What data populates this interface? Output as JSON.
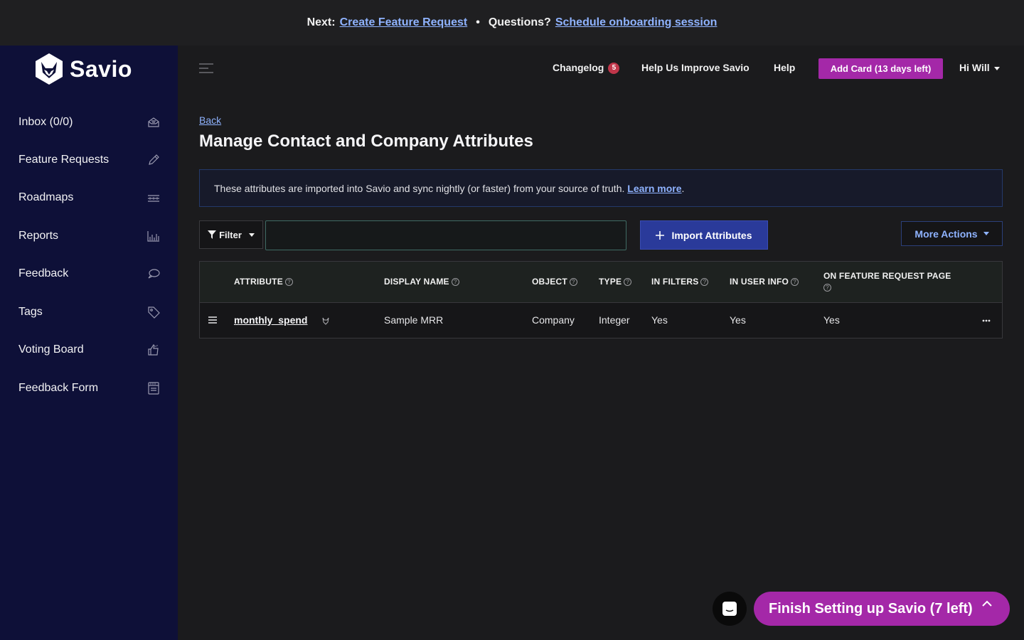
{
  "banner": {
    "next_label": "Next:",
    "next_link": "Create Feature Request",
    "separator": "•",
    "questions_label": "Questions?",
    "questions_link": "Schedule onboarding session"
  },
  "brand": {
    "name": "Savio"
  },
  "sidebar": {
    "items": [
      {
        "label": "Inbox (0/0)",
        "icon": "inbox-icon"
      },
      {
        "label": "Feature Requests",
        "icon": "pencil-icon"
      },
      {
        "label": "Roadmaps",
        "icon": "roadmap-icon"
      },
      {
        "label": "Reports",
        "icon": "chart-icon"
      },
      {
        "label": "Feedback",
        "icon": "chat-bubble-icon"
      },
      {
        "label": "Tags",
        "icon": "tag-icon"
      },
      {
        "label": "Voting Board",
        "icon": "thumbs-up-icon"
      },
      {
        "label": "Feedback Form",
        "icon": "form-icon"
      }
    ]
  },
  "header": {
    "changelog": "Changelog",
    "changelog_count": "5",
    "improve": "Help Us Improve Savio",
    "help": "Help",
    "add_card": "Add Card (13 days left)",
    "user": "Hi Will"
  },
  "page": {
    "back": "Back",
    "title": "Manage Contact and Company Attributes",
    "info_text": "These attributes are imported into Savio and sync nightly (or faster) from your source of truth.",
    "info_link": "Learn more",
    "info_tail": "."
  },
  "toolbar": {
    "filter": "Filter",
    "search_value": "",
    "import": "Import Attributes",
    "more_actions": "More Actions"
  },
  "table": {
    "columns": [
      "ATTRIBUTE",
      "DISPLAY NAME",
      "OBJECT",
      "TYPE",
      "IN FILTERS",
      "IN USER INFO",
      "ON FEATURE REQUEST PAGE"
    ],
    "rows": [
      {
        "attribute": "monthly_spend",
        "display_name": "Sample MRR",
        "object": "Company",
        "type": "Integer",
        "in_filters": "Yes",
        "in_user_info": "Yes",
        "on_fr_page": "Yes"
      }
    ]
  },
  "footer": {
    "finish": "Finish Setting up Savio (7 left)"
  },
  "colors": {
    "sidebar_bg": "#0e1038",
    "accent_purple": "#a428a8",
    "link_blue": "#8fb3ff",
    "primary_blue": "#2a3a9a"
  }
}
